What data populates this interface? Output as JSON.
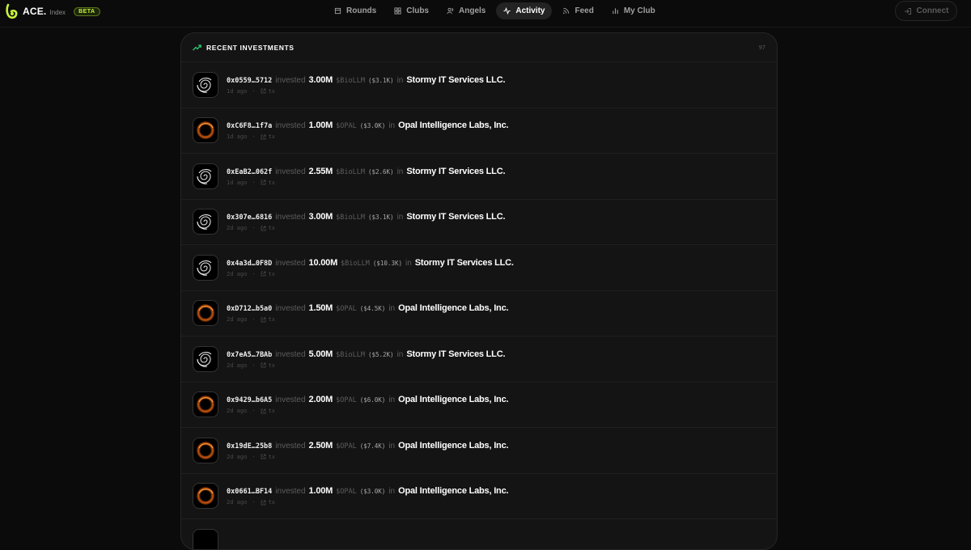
{
  "brand": {
    "name": "ACE.",
    "sub": "Index",
    "badge": "BETA",
    "accent": "#c6f13a"
  },
  "nav": [
    {
      "label": "Rounds",
      "icon": "building-icon",
      "active": false
    },
    {
      "label": "Clubs",
      "icon": "grid-icon",
      "active": false
    },
    {
      "label": "Angels",
      "icon": "users-icon",
      "active": false
    },
    {
      "label": "Activity",
      "icon": "activity-icon",
      "active": true
    },
    {
      "label": "Feed",
      "icon": "rss-icon",
      "active": false
    },
    {
      "label": "My Club",
      "icon": "bar-chart-icon",
      "active": false
    }
  ],
  "connect": {
    "label": "Connect"
  },
  "panel": {
    "title": "RECENT INVESTMENTS",
    "count": "97"
  },
  "investments": [
    {
      "address": "0x0559…5712",
      "verb": "invested",
      "amount": "3.00M",
      "token": "$BioLLM",
      "usd": "($3.1K)",
      "prep": "in",
      "company": "Stormy IT Services LLC.",
      "time": "1d ago",
      "sep": "·",
      "tx": "tx",
      "logo": "stormy"
    },
    {
      "address": "0xC6F8…1f7a",
      "verb": "invested",
      "amount": "1.00M",
      "token": "$OPAL",
      "usd": "($3.0K)",
      "prep": "in",
      "company": "Opal Intelligence Labs, Inc.",
      "time": "1d ago",
      "sep": "·",
      "tx": "tx",
      "logo": "opal"
    },
    {
      "address": "0xEaB2…062f",
      "verb": "invested",
      "amount": "2.55M",
      "token": "$BioLLM",
      "usd": "($2.6K)",
      "prep": "in",
      "company": "Stormy IT Services LLC.",
      "time": "1d ago",
      "sep": "·",
      "tx": "tx",
      "logo": "stormy"
    },
    {
      "address": "0x307e…6816",
      "verb": "invested",
      "amount": "3.00M",
      "token": "$BioLLM",
      "usd": "($3.1K)",
      "prep": "in",
      "company": "Stormy IT Services LLC.",
      "time": "2d ago",
      "sep": "·",
      "tx": "tx",
      "logo": "stormy"
    },
    {
      "address": "0x4a3d…0F8D",
      "verb": "invested",
      "amount": "10.00M",
      "token": "$BioLLM",
      "usd": "($10.3K)",
      "prep": "in",
      "company": "Stormy IT Services LLC.",
      "time": "2d ago",
      "sep": "·",
      "tx": "tx",
      "logo": "stormy"
    },
    {
      "address": "0xD712…b5a0",
      "verb": "invested",
      "amount": "1.50M",
      "token": "$OPAL",
      "usd": "($4.5K)",
      "prep": "in",
      "company": "Opal Intelligence Labs, Inc.",
      "time": "2d ago",
      "sep": "·",
      "tx": "tx",
      "logo": "opal"
    },
    {
      "address": "0x7eA5…7BAb",
      "verb": "invested",
      "amount": "5.00M",
      "token": "$BioLLM",
      "usd": "($5.2K)",
      "prep": "in",
      "company": "Stormy IT Services LLC.",
      "time": "2d ago",
      "sep": "·",
      "tx": "tx",
      "logo": "stormy"
    },
    {
      "address": "0x9429…b6A5",
      "verb": "invested",
      "amount": "2.00M",
      "token": "$OPAL",
      "usd": "($6.0K)",
      "prep": "in",
      "company": "Opal Intelligence Labs, Inc.",
      "time": "2d ago",
      "sep": "·",
      "tx": "tx",
      "logo": "opal"
    },
    {
      "address": "0x19dE…25b8",
      "verb": "invested",
      "amount": "2.50M",
      "token": "$OPAL",
      "usd": "($7.4K)",
      "prep": "in",
      "company": "Opal Intelligence Labs, Inc.",
      "time": "2d ago",
      "sep": "·",
      "tx": "tx",
      "logo": "opal"
    },
    {
      "address": "0x0661…BF14",
      "verb": "invested",
      "amount": "1.00M",
      "token": "$OPAL",
      "usd": "($3.0K)",
      "prep": "in",
      "company": "Opal Intelligence Labs, Inc.",
      "time": "2d ago",
      "sep": "·",
      "tx": "tx",
      "logo": "opal"
    }
  ]
}
